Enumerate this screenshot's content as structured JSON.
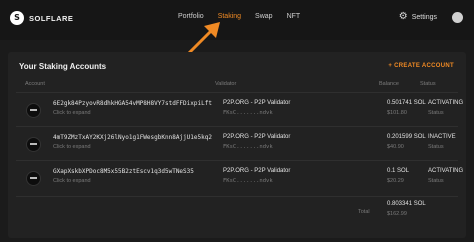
{
  "header": {
    "logo_mark": "S",
    "logo_text": "SOLFLARE",
    "tabs": [
      "Portfolio",
      "Staking",
      "Swap",
      "NFT"
    ],
    "active_tab": "Staking",
    "settings_label": "Settings",
    "settings_icon": "gear-icon"
  },
  "colors": {
    "accent": "#f08a24",
    "background": "#1b1b1b",
    "panel": "#222222"
  },
  "panel": {
    "title": "Your Staking Accounts",
    "create_label": "+ CREATE ACCOUNT",
    "columns": {
      "account": "Account",
      "validator": "Validator",
      "balance": "Balance",
      "status": "Status"
    }
  },
  "accounts": [
    {
      "address": "6E2gk84PzyovR8dhkHGA54vMP8H8VY7stdFFDixpiLft",
      "expand": "Click to expand",
      "validator": "P2P.ORG - P2P Validator",
      "validator_sub": "FKsC.......ndvk",
      "balance": "0.501741 SOL",
      "usd": "$101.80",
      "status": "ACTIVATING",
      "status_sub": "Status"
    },
    {
      "address": "4mT9ZMzTxAY2KXj26lNyo1g1FWesgbKnn8AjjU1e5kq2",
      "expand": "Click to expand",
      "validator": "P2P.ORG - P2P Validator",
      "validator_sub": "FKsC.......ndvk",
      "balance": "0.201599 SOL",
      "usd": "$40.90",
      "status": "INACTIVE",
      "status_sub": "Status"
    },
    {
      "address": "GXapXskbXPDoc8M5x55B2ztEscv1q3d5wTNeS35",
      "expand": "Click to expand",
      "validator": "P2P.ORG - P2P Validator",
      "validator_sub": "FKsC.......ndvk",
      "balance": "0.1 SOL",
      "usd": "$20.29",
      "status": "ACTIVATING",
      "status_sub": "Status"
    }
  ],
  "total": {
    "label": "Total",
    "sol": "0.803341 SOL",
    "usd": "$162.99"
  }
}
